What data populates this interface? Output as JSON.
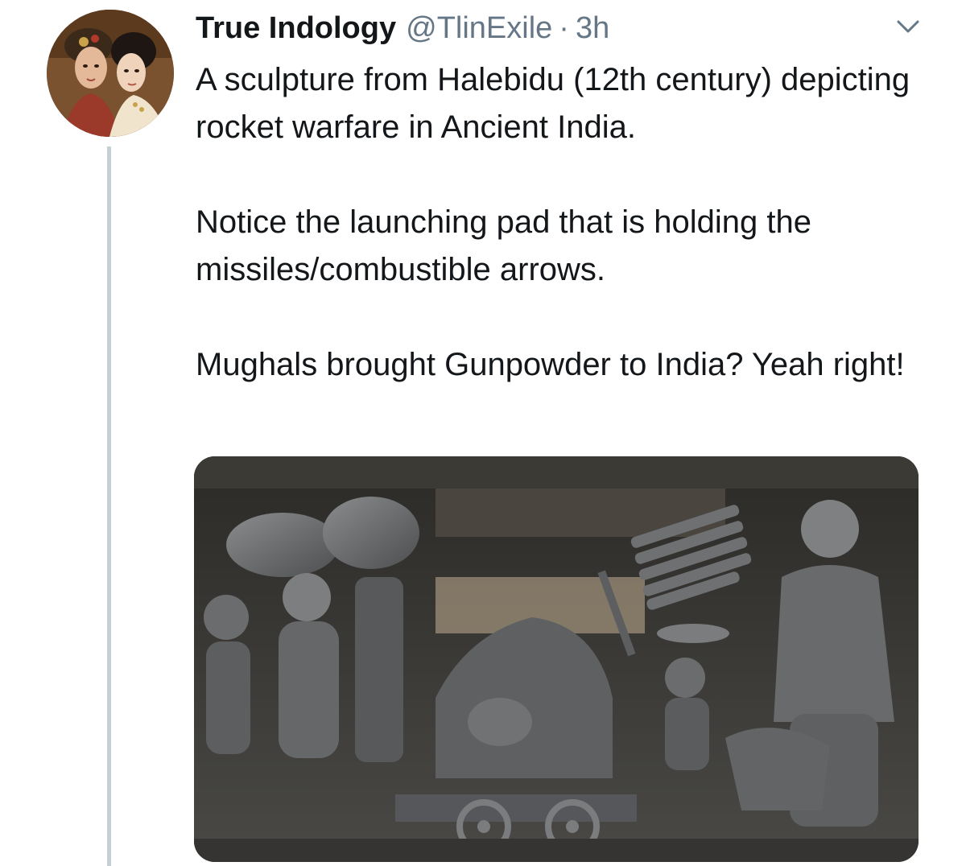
{
  "tweet": {
    "display_name": "True Indology",
    "handle": "@TlinExile",
    "separator": "·",
    "time": "3h",
    "paragraphs": [
      "A sculpture from Halebidu (12th century) depicting rocket warfare in Ancient India.",
      "Notice the launching pad that is holding the missiles/combustible arrows.",
      "Mughals brought Gunpowder to India? Yeah right!"
    ],
    "avatar_icon": "avatar-painting",
    "menu_icon": "chevron-down-icon",
    "media_description_icon": "sculpture-photo"
  },
  "colors": {
    "text": "#14171a",
    "secondary": "#657786",
    "thread_line": "#c4cfd6"
  }
}
